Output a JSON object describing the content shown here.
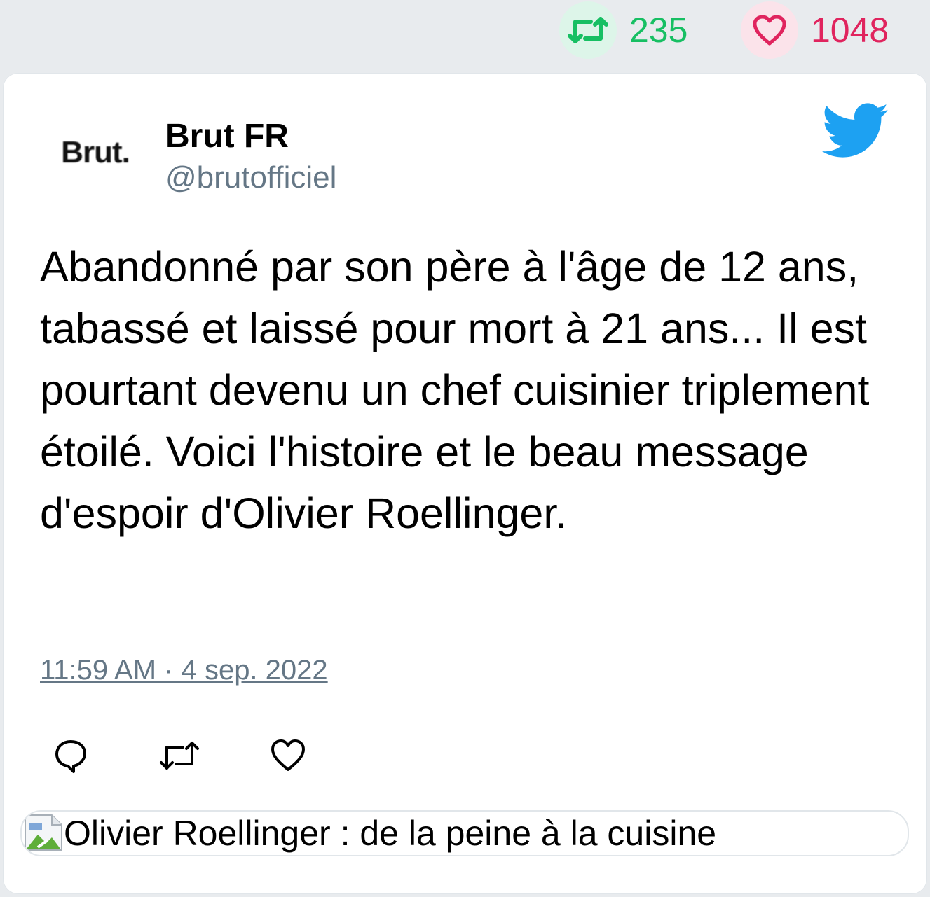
{
  "stats": {
    "retweets": "235",
    "likes": "1048",
    "retweet_color": "#17bf63",
    "like_color": "#e0245e"
  },
  "tweet": {
    "avatar_text": "Brut.",
    "author_name": "Brut FR",
    "author_handle": "@brutofficiel",
    "text": "Abandonné par son père à l'âge de 12 ans, tabassé et laissé pour mort à 21 ans... Il est pourtant devenu un chef cuisinier triplement étoilé. Voici l'histoire et le beau message d'espoir d'Olivier Roellinger.",
    "timestamp": "11:59 AM · 4 sep. 2022",
    "brand_icon": "twitter-bird-icon",
    "brand_color": "#1da1f2"
  },
  "actions": [
    "reply-icon",
    "retweet-icon",
    "like-icon"
  ],
  "preview": {
    "title": "Olivier Roellinger : de la peine à la cuisine",
    "image_icon": "broken-image-icon"
  }
}
